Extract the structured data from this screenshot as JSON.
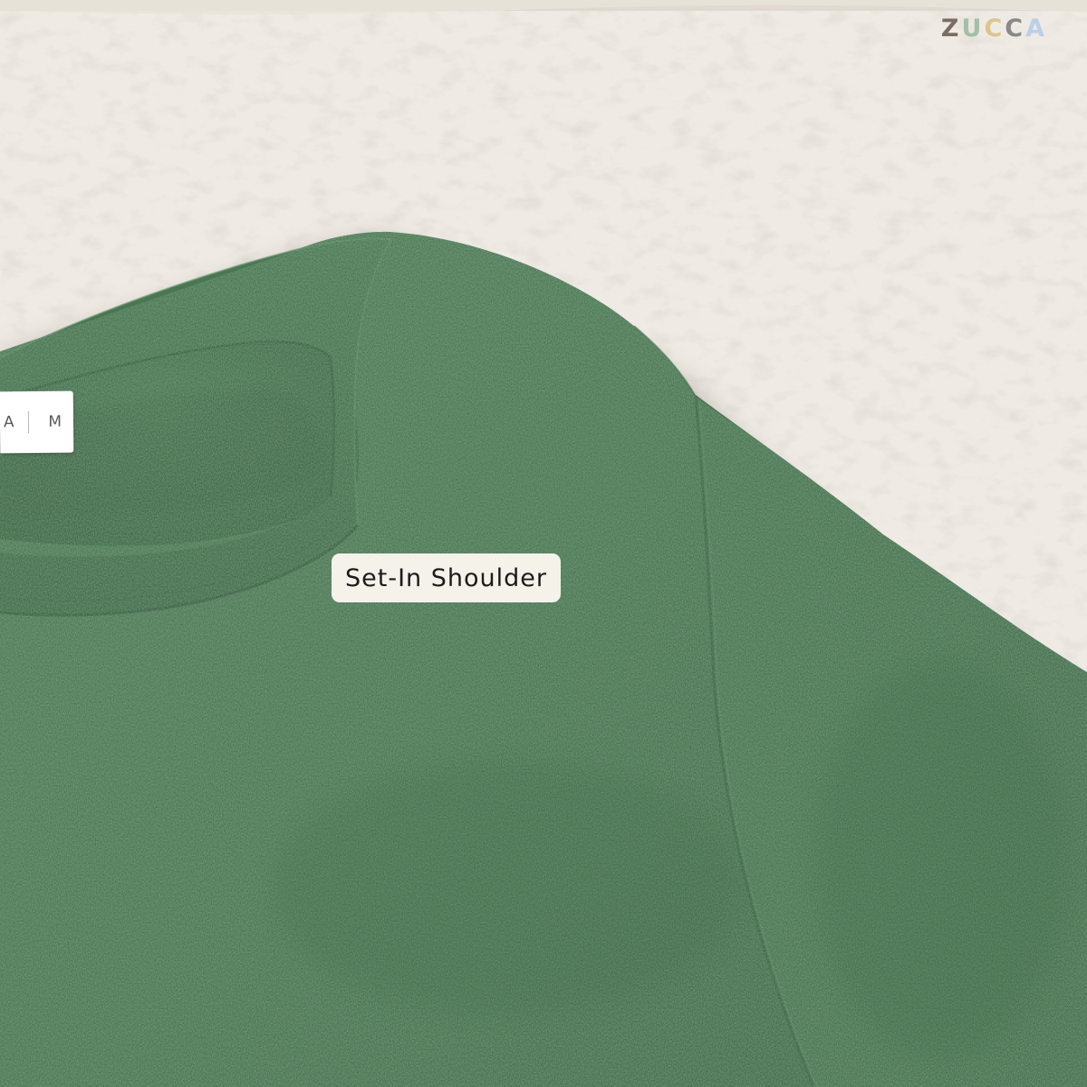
{
  "brand": {
    "letters": [
      {
        "char": "Z",
        "color": "#7b6d63"
      },
      {
        "char": "U",
        "color": "#a2bfa8"
      },
      {
        "char": "C",
        "color": "#dcc58e"
      },
      {
        "char": "C",
        "color": "#8a8888"
      },
      {
        "char": "A",
        "color": "#b9d0e7"
      }
    ]
  },
  "callout": {
    "text": "Set-In Shoulder",
    "bg": "#f5f2ea",
    "fg": "#1b1b1b"
  },
  "label": {
    "fragment": "A",
    "size": "M"
  },
  "colors": {
    "shirt": "#4d7a56",
    "shirt_dark": "#3e6747",
    "rug": "#efebe4",
    "rug_shadow": "#d8d1c4"
  },
  "icons": [
    "rug-texture",
    "tshirt-image"
  ]
}
